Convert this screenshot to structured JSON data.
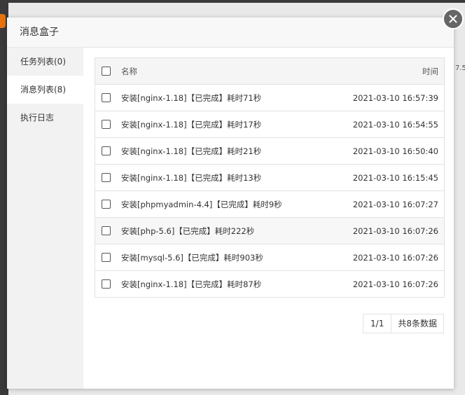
{
  "dialog": {
    "title": "消息盒子"
  },
  "sidebar": {
    "items": [
      {
        "label": "任务列表(0)"
      },
      {
        "label": "消息列表(8)"
      },
      {
        "label": "执行日志"
      }
    ]
  },
  "table": {
    "header": {
      "name": "名称",
      "time": "时间"
    },
    "rows": [
      {
        "name": "安装[nginx-1.18]【已完成】耗时71秒",
        "time": "2021-03-10 16:57:39"
      },
      {
        "name": "安装[nginx-1.18]【已完成】耗时17秒",
        "time": "2021-03-10 16:54:55"
      },
      {
        "name": "安装[nginx-1.18]【已完成】耗时21秒",
        "time": "2021-03-10 16:50:40"
      },
      {
        "name": "安装[nginx-1.18]【已完成】耗时13秒",
        "time": "2021-03-10 16:15:45"
      },
      {
        "name": "安装[phpmyadmin-4.4]【已完成】耗时9秒",
        "time": "2021-03-10 16:07:27"
      },
      {
        "name": "安装[php-5.6]【已完成】耗时222秒",
        "time": "2021-03-10 16:07:26"
      },
      {
        "name": "安装[mysql-5.6]【已完成】耗时903秒",
        "time": "2021-03-10 16:07:26"
      },
      {
        "name": "安装[nginx-1.18]【已完成】耗时87秒",
        "time": "2021-03-10 16:07:26"
      }
    ]
  },
  "pager": {
    "page": "1/1",
    "total": "共8条数据"
  },
  "background": {
    "fragment": "7.5"
  },
  "icons": {
    "close": "close-icon"
  }
}
